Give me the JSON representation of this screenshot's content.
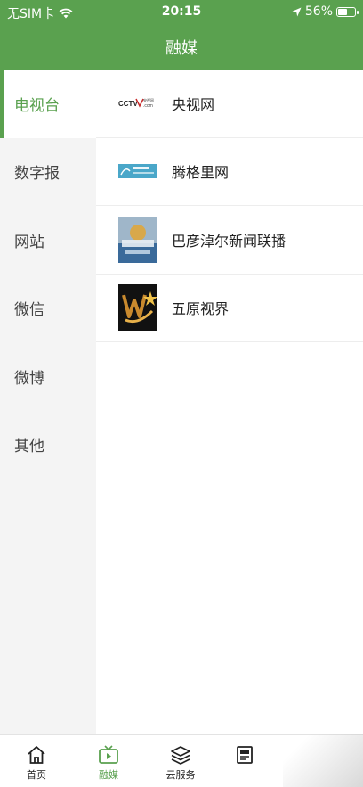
{
  "status_bar": {
    "carrier": "无SIM卡",
    "time": "20:15",
    "battery_percent": "56%",
    "battery_level": 0.56
  },
  "nav": {
    "title": "融媒"
  },
  "sidebar": {
    "items": [
      {
        "label": "电视台",
        "active": true
      },
      {
        "label": "数字报"
      },
      {
        "label": "网站"
      },
      {
        "label": "微信"
      },
      {
        "label": "微博"
      },
      {
        "label": "其他"
      }
    ]
  },
  "list": {
    "items": [
      {
        "label": "央视网",
        "logo": "cctv-logo",
        "logo_text": "CCTV.com"
      },
      {
        "label": "腾格里网",
        "logo": "tenggeli-logo",
        "logo_text": "腾格里网"
      },
      {
        "label": "巴彦淖尔新闻联播",
        "logo": "news-broadcast-logo"
      },
      {
        "label": "五原视界",
        "logo": "wuyuan-logo"
      }
    ]
  },
  "tabbar": {
    "items": [
      {
        "label": "首页",
        "icon": "home-icon"
      },
      {
        "label": "融媒",
        "icon": "tv-icon",
        "active": true
      },
      {
        "label": "云服务",
        "icon": "layers-icon"
      },
      {
        "label": "",
        "icon": "newspaper-icon"
      }
    ]
  },
  "colors": {
    "accent": "#5aa14f",
    "sidebar_bg": "#f4f4f4"
  }
}
